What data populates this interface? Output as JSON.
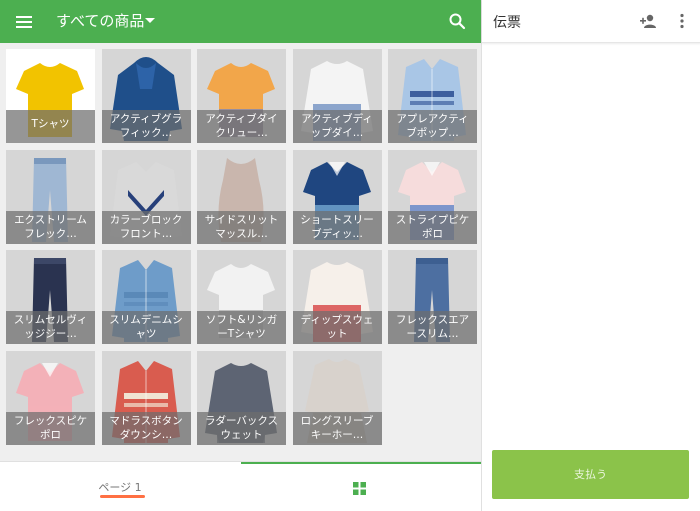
{
  "colors": {
    "accent": "#4caf50",
    "pay": "#8bc34a",
    "page_indicator": "#ff7043"
  },
  "header": {
    "title": "すべての商品"
  },
  "icons": {
    "menu": "menu-icon",
    "dropdown": "dropdown-caret-icon",
    "search": "search-icon",
    "grid": "grid-view-icon",
    "add_customer": "add-person-icon",
    "more": "more-vertical-icon"
  },
  "products": [
    {
      "name": "Tシャツ",
      "one_line": true
    },
    {
      "name": "アクティブグラフィック…"
    },
    {
      "name": "アクティブダイクリュー…"
    },
    {
      "name": "アクティブディップダイ…"
    },
    {
      "name": "アプレアクティブポップ…"
    },
    {
      "name": "エクストリームフレック…"
    },
    {
      "name": "カラーブロックフロント…"
    },
    {
      "name": "サイドスリットマッスル…"
    },
    {
      "name": "ショートスリーブディッ…"
    },
    {
      "name": "ストライプピケポロ"
    },
    {
      "name": "スリムセルヴィッジジー…"
    },
    {
      "name": "スリムデニムシャツ"
    },
    {
      "name": "ソフト&リンガーTシャツ"
    },
    {
      "name": "ディップスウェット"
    },
    {
      "name": "フレックスエアースリム…"
    },
    {
      "name": "フレックスピケポロ"
    },
    {
      "name": "マドラスボタンダウンシ…"
    },
    {
      "name": "ラダーバックスウェット"
    },
    {
      "name": "ロングスリーブキーホー…"
    }
  ],
  "bottom_nav": {
    "page_label": "ページ 1"
  },
  "ticket": {
    "title": "伝票",
    "pay_label": "支払う"
  }
}
